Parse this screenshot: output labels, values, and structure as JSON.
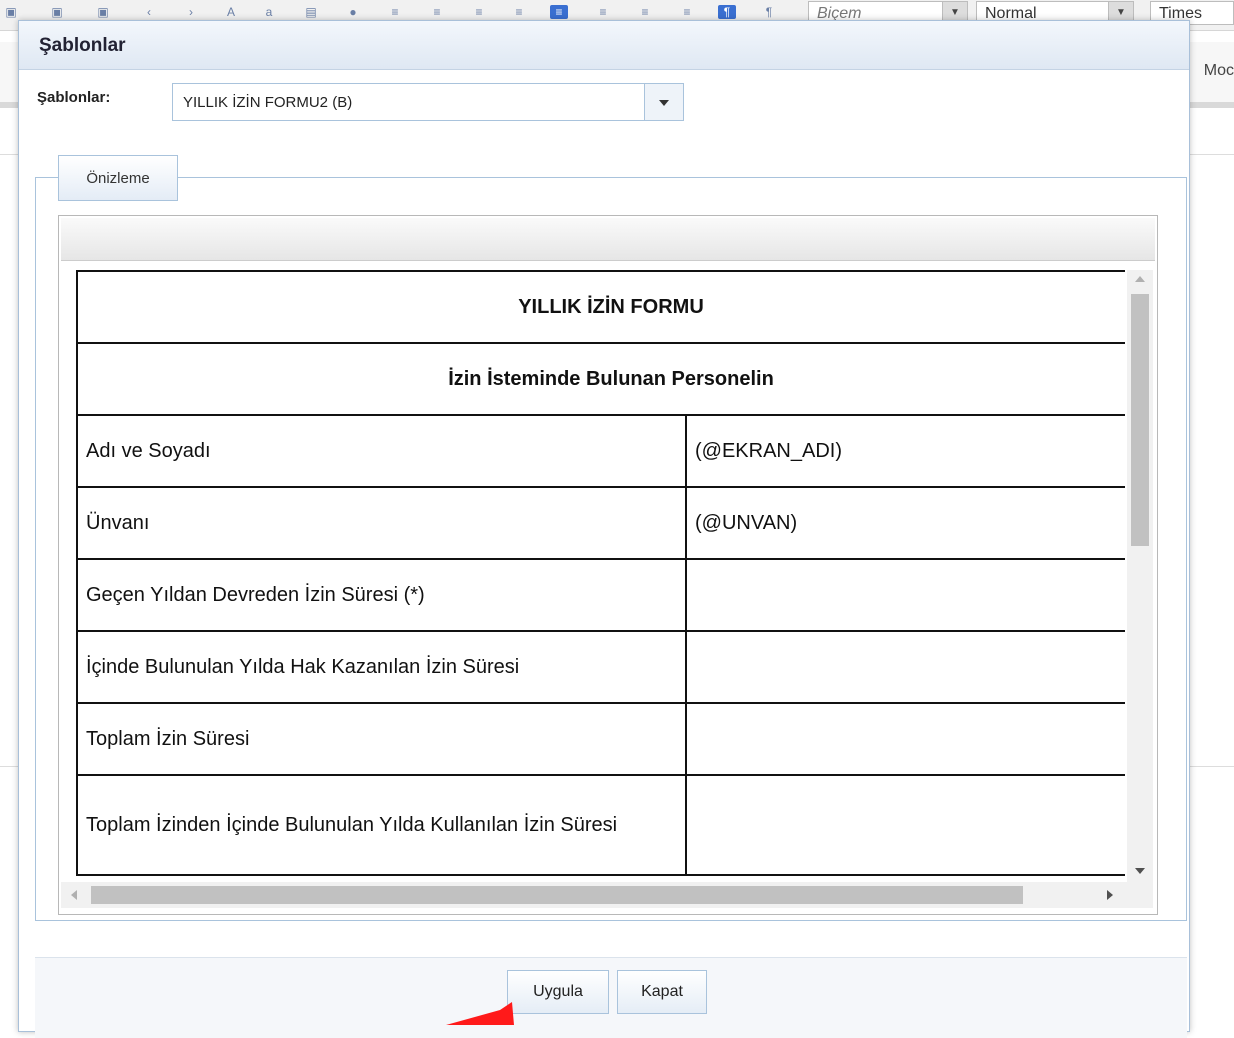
{
  "editor": {
    "toolbar": {
      "style_combo": "Biçem",
      "format_combo": "Normal",
      "font_combo": "Times"
    },
    "partial_label": "Moc"
  },
  "dialog": {
    "title": "Şablonlar",
    "template_label": "Şablonlar:",
    "template_value": "YILLIK İZİN FORMU2 (B)",
    "preview_tab": "Önizleme",
    "form": {
      "title": "YILLIK İZİN FORMU",
      "subtitle": "İzin İsteminde Bulunan Personelin",
      "rows": [
        {
          "label": "Adı ve Soyadı",
          "value": "(@EKRAN_ADI)"
        },
        {
          "label": "Ünvanı",
          "value": "(@UNVAN)"
        },
        {
          "label": "Geçen Yıldan Devreden İzin Süresi (*)",
          "value": ""
        },
        {
          "label": "İçinde Bulunulan Yılda Hak Kazanılan İzin Süresi",
          "value": ""
        },
        {
          "label": "Toplam İzin Süresi",
          "value": ""
        },
        {
          "label": "Toplam İzinden İçinde Bulunulan Yılda Kullanılan İzin Süresi",
          "value": ""
        }
      ]
    },
    "buttons": {
      "apply": "Uygula",
      "close": "Kapat"
    }
  },
  "colors": {
    "arrow": "#ff1a1a",
    "dialog_border": "#a9c0d9",
    "active_tool": "#3a6fd1"
  }
}
